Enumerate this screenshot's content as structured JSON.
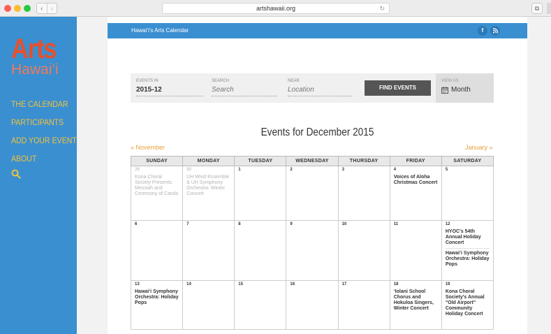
{
  "browser": {
    "url": "artshawaii.org"
  },
  "sidebar": {
    "logo_line1": "Arts",
    "logo_line2": "Hawai‘i",
    "items": [
      {
        "label": "THE CALENDAR"
      },
      {
        "label": "PARTICIPANTS"
      },
      {
        "label": "ADD YOUR EVENT"
      },
      {
        "label": "ABOUT"
      }
    ]
  },
  "header": {
    "title": "Hawai‘i's Arts Calendar",
    "fb": "f",
    "rss": "◠"
  },
  "search": {
    "events_in_label": "EVENTS IN",
    "events_in_value": "2015-12",
    "search_label": "SEARCH",
    "search_placeholder": "Search",
    "near_label": "NEAR",
    "near_placeholder": "Location",
    "find_button": "FIND EVENTS",
    "view_as_label": "VIEW AS",
    "view_as_value": "Month"
  },
  "calendar": {
    "title": "Events for December 2015",
    "prev": "« November",
    "next": "January »",
    "days": [
      "SUNDAY",
      "MONDAY",
      "TUESDAY",
      "WEDNESDAY",
      "THURSDAY",
      "FRIDAY",
      "SATURDAY"
    ],
    "weeks": [
      [
        {
          "num": "29",
          "events": [
            "Kona Choral Society Presents: Messiah and Ceremony of Carols"
          ]
        },
        {
          "num": "30",
          "events": [
            "UH Wind Ensemble & UH Symphony Orchestra: Winter Concert"
          ]
        },
        {
          "num": "1",
          "events": []
        },
        {
          "num": "2",
          "events": []
        },
        {
          "num": "3",
          "events": []
        },
        {
          "num": "4",
          "events": [
            "Voices of Aloha Christmas Concert"
          ]
        },
        {
          "num": "5",
          "events": []
        }
      ],
      [
        {
          "num": "6",
          "events": []
        },
        {
          "num": "7",
          "events": []
        },
        {
          "num": "8",
          "events": []
        },
        {
          "num": "9",
          "events": []
        },
        {
          "num": "10",
          "events": []
        },
        {
          "num": "11",
          "events": []
        },
        {
          "num": "12",
          "events": [
            "HYOC's 54th Annual Holiday Concert",
            "Hawai‘i Symphony Orchestra: Holiday Pops"
          ]
        }
      ],
      [
        {
          "num": "13",
          "events": [
            "Hawai‘i Symphony Orchestra: Holiday Pops"
          ]
        },
        {
          "num": "14",
          "events": []
        },
        {
          "num": "15",
          "events": []
        },
        {
          "num": "16",
          "events": []
        },
        {
          "num": "17",
          "events": []
        },
        {
          "num": "18",
          "events": [
            "‘Iolani School Chorus and Hokuloa Singers, Winter Concert"
          ]
        },
        {
          "num": "19",
          "events": [
            "Kona Choral Society's Annual \"Old Airport\" Community Holiday Concert"
          ]
        }
      ]
    ]
  }
}
